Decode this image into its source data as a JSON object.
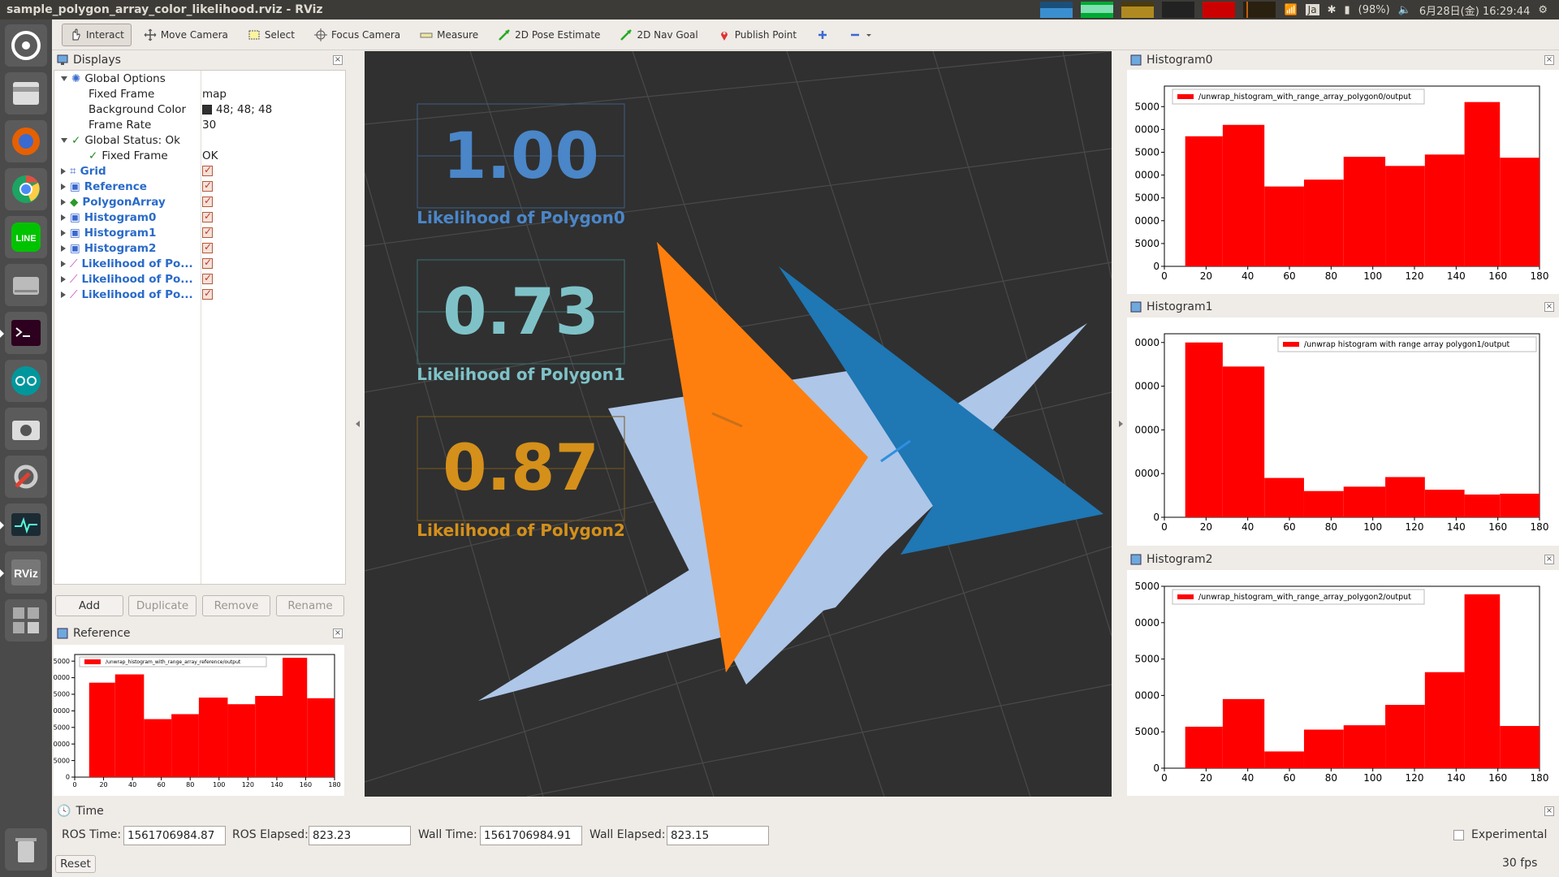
{
  "window": {
    "title": "sample_polygon_array_color_likelihood.rviz - RViz"
  },
  "tray": {
    "ime": "Ja",
    "battery": "(98%)",
    "datetime": "6月28日(金) 16:29:44"
  },
  "launcher": [
    {
      "name": "dash-icon"
    },
    {
      "name": "files-icon"
    },
    {
      "name": "firefox-icon"
    },
    {
      "name": "chrome-icon"
    },
    {
      "name": "line-icon"
    },
    {
      "name": "disk-icon"
    },
    {
      "name": "terminal-icon"
    },
    {
      "name": "arduino-icon"
    },
    {
      "name": "camera-icon"
    },
    {
      "name": "settings-icon"
    },
    {
      "name": "system-monitor-icon"
    },
    {
      "name": "rviz-icon"
    },
    {
      "name": "workspace-icon"
    },
    {
      "name": "trash-icon"
    }
  ],
  "toolbar": {
    "interact": "Interact",
    "move_camera": "Move Camera",
    "select": "Select",
    "focus_camera": "Focus Camera",
    "measure": "Measure",
    "pose_estimate": "2D Pose Estimate",
    "nav_goal": "2D Nav Goal",
    "publish_point": "Publish Point"
  },
  "displays": {
    "title": "Displays",
    "global_options": "Global Options",
    "fixed_frame_label": "Fixed Frame",
    "fixed_frame_value": "map",
    "bg_color_label": "Background Color",
    "bg_color_value": "48; 48; 48",
    "frame_rate_label": "Frame Rate",
    "frame_rate_value": "30",
    "global_status": "Global Status: Ok",
    "status_fixed_frame_label": "Fixed Frame",
    "status_fixed_frame_value": "OK",
    "items": [
      "Grid",
      "Reference",
      "PolygonArray",
      "Histogram0",
      "Histogram1",
      "Histogram2",
      "Likelihood of Po...",
      "Likelihood of Po...",
      "Likelihood of Po..."
    ],
    "buttons": {
      "add": "Add",
      "duplicate": "Duplicate",
      "remove": "Remove",
      "rename": "Rename"
    }
  },
  "reference": {
    "title": "Reference",
    "legend": "/unwrap_histogram_with_range_array_reference/output"
  },
  "likelihood": [
    {
      "value": "1.00",
      "label": "Likelihood of Polygon0",
      "color": "#4a86c8"
    },
    {
      "value": "0.73",
      "label": "Likelihood of Polygon1",
      "color": "#7ec2c8"
    },
    {
      "value": "0.87",
      "label": "Likelihood of Polygon2",
      "color": "#d4901a"
    }
  ],
  "histograms": [
    {
      "title": "Histogram0",
      "legend": "/unwrap_histogram_with_range_array_polygon0/output"
    },
    {
      "title": "Histogram1",
      "legend": "/unwrap histogram with range array polygon1/output"
    },
    {
      "title": "Histogram2",
      "legend": "/unwrap_histogram_with_range_array_polygon2/output"
    }
  ],
  "chart_data": [
    {
      "type": "bar",
      "title": "Histogram0",
      "legend": "/unwrap_histogram_with_range_array_polygon0/output",
      "x_edges": [
        10,
        28,
        48,
        67,
        86,
        106,
        125,
        144,
        161,
        180
      ],
      "values": [
        28500,
        31000,
        17500,
        19000,
        24000,
        22000,
        24500,
        36000,
        23800
      ],
      "xlim": [
        0,
        180
      ],
      "ylim": [
        0,
        39500
      ],
      "yticks": [
        0,
        5000,
        10000,
        15000,
        20000,
        25000,
        30000,
        35000
      ],
      "ytick_labels": [
        "0",
        "5000",
        "0000",
        "5000",
        "0000",
        "5000",
        "0000",
        "5000"
      ],
      "xticks": [
        0,
        20,
        40,
        60,
        80,
        100,
        120,
        140,
        160,
        180
      ]
    },
    {
      "type": "bar",
      "title": "Histogram1",
      "legend": "/unwrap histogram with range array polygon1/output",
      "x_edges": [
        10,
        28,
        48,
        67,
        86,
        106,
        125,
        144,
        161,
        180
      ],
      "values": [
        40000,
        34500,
        9000,
        6000,
        7000,
        9200,
        6300,
        5200,
        5400
      ],
      "xlim": [
        0,
        180
      ],
      "ylim": [
        0,
        42000
      ],
      "yticks": [
        0,
        10000,
        20000,
        30000,
        40000
      ],
      "ytick_labels": [
        "0",
        "0000",
        "0000",
        "0000",
        "0000"
      ],
      "xticks": [
        0,
        20,
        40,
        60,
        80,
        100,
        120,
        140,
        160,
        180
      ]
    },
    {
      "type": "bar",
      "title": "Histogram2",
      "legend": "/unwrap_histogram_with_range_array_polygon2/output",
      "x_edges": [
        10,
        28,
        48,
        67,
        86,
        106,
        125,
        144,
        161,
        180
      ],
      "values": [
        5700,
        9500,
        2300,
        5300,
        5900,
        8700,
        13200,
        23900,
        5800
      ],
      "xlim": [
        0,
        180
      ],
      "ylim": [
        0,
        25000
      ],
      "yticks": [
        0,
        5000,
        10000,
        15000,
        20000,
        25000
      ],
      "ytick_labels": [
        "0",
        "5000",
        "0000",
        "5000",
        "0000",
        "5000"
      ],
      "xticks": [
        0,
        20,
        40,
        60,
        80,
        100,
        120,
        140,
        160,
        180
      ]
    },
    {
      "type": "bar",
      "title": "Reference",
      "legend": "/unwrap_histogram_with_range_array_reference/output",
      "x_edges": [
        10,
        28,
        48,
        67,
        86,
        106,
        125,
        144,
        161,
        180
      ],
      "values": [
        28500,
        31000,
        17500,
        19000,
        24000,
        22000,
        24500,
        36000,
        23800
      ],
      "xlim": [
        0,
        180
      ],
      "ylim": [
        0,
        37000
      ],
      "yticks": [
        0,
        5000,
        10000,
        15000,
        20000,
        25000,
        30000,
        35000
      ],
      "ytick_labels": [
        "0",
        ",5000",
        "0000",
        "5000",
        "0000",
        "5000",
        "0000",
        "5000"
      ],
      "xticks": [
        0,
        20,
        40,
        60,
        80,
        100,
        120,
        140,
        160,
        180
      ]
    }
  ],
  "time": {
    "title": "Time",
    "ros_time_label": "ROS Time:",
    "ros_time": "1561706984.87",
    "ros_elapsed_label": "ROS Elapsed:",
    "ros_elapsed": "823.23",
    "wall_time_label": "Wall Time:",
    "wall_time": "1561706984.91",
    "wall_elapsed_label": "Wall Elapsed:",
    "wall_elapsed": "823.15",
    "experimental": "Experimental",
    "reset": "Reset",
    "fps": "30 fps"
  }
}
